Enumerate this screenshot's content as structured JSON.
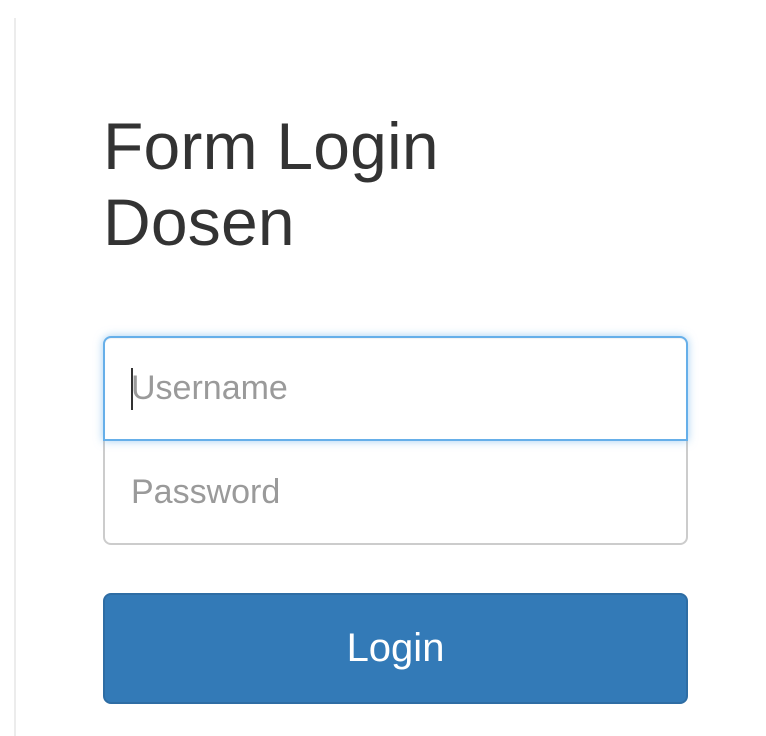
{
  "login_form": {
    "title": "Form Login\nDosen",
    "username": {
      "placeholder": "Username",
      "value": ""
    },
    "password": {
      "placeholder": "Password",
      "value": ""
    },
    "submit_label": "Login"
  },
  "colors": {
    "button_background": "#337ab7",
    "button_text": "#ffffff",
    "focus_border": "#66afe9",
    "title_text": "#333333",
    "placeholder_text": "#9a9a9a"
  }
}
